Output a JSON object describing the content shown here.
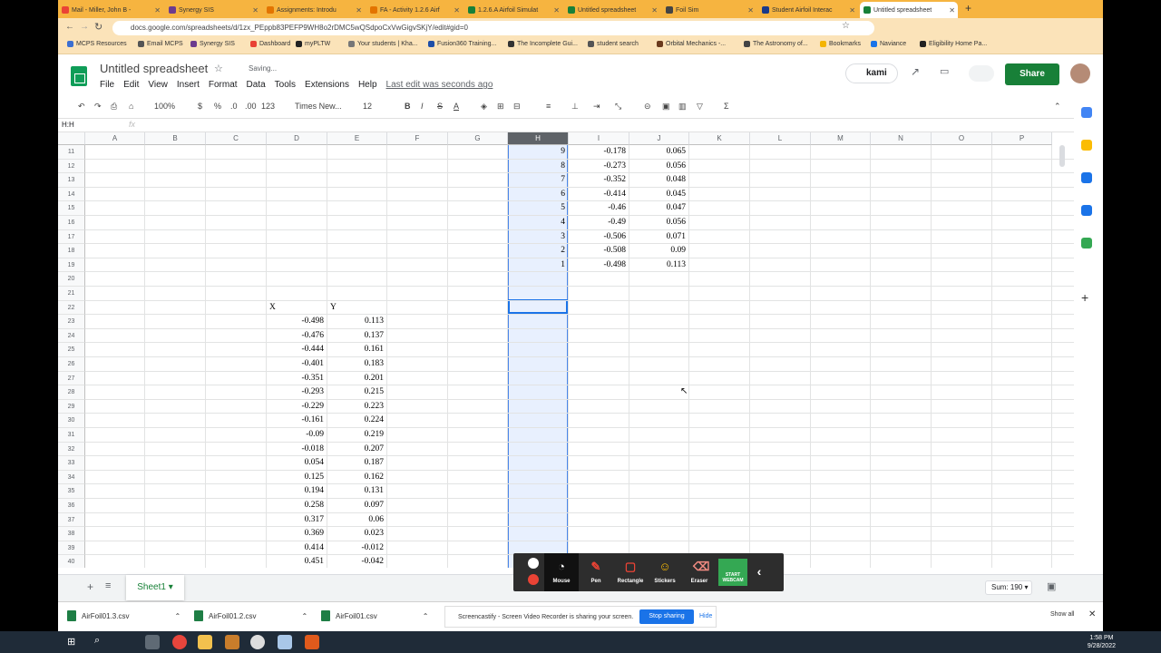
{
  "browser": {
    "tabs": [
      {
        "label": "Mail - Miller, John B -",
        "color": "#ea4335"
      },
      {
        "label": "Synergy SIS",
        "color": "#6d3b8e"
      },
      {
        "label": "Assignments: Introdu",
        "color": "#e37400"
      },
      {
        "label": "FA - Activity 1.2.6 Airf",
        "color": "#e37400"
      },
      {
        "label": "1.2.6.A Airfoil Simulat",
        "color": "#188038"
      },
      {
        "label": "Untitled spreadsheet",
        "color": "#188038"
      },
      {
        "label": "Foil Sim",
        "color": "#444444"
      },
      {
        "label": "Student Airfoil Interac",
        "color": "#1a3a8a"
      },
      {
        "label": "Untitled spreadsheet",
        "color": "#188038"
      }
    ],
    "url": "docs.google.com/spreadsheets/d/1zx_PEppb83PEFP9WH8o2rDMC5wQSdpoCxVwGigvSKjY/edit#gid=0",
    "bookmarks": [
      "MCPS Resources",
      "Email MCPS",
      "Synergy SIS",
      "Dashboard",
      "myPLTW",
      "Your students | Kha...",
      "Fusion360 Training...",
      "The Incomplete Gui...",
      "student search",
      "Orbital Mechanics -...",
      "The Astronomy of...",
      "Bookmarks",
      "Naviance",
      "Eligibility Home Pa..."
    ]
  },
  "sheets": {
    "title": "Untitled spreadsheet",
    "saving": "Saving...",
    "menu": [
      "File",
      "Edit",
      "View",
      "Insert",
      "Format",
      "Data",
      "Tools",
      "Extensions",
      "Help"
    ],
    "last_edit": "Last edit was seconds ago",
    "kami_label": "kami",
    "share_label": "Share",
    "toolbar": {
      "zoom": "100%",
      "currency": "$",
      "percent": "%",
      "dec_less": ".0",
      "dec_more": ".00",
      "format_more": "123",
      "font": "Times New...",
      "font_size": "12"
    },
    "name_box": "H:H",
    "fx": "fx",
    "columns": [
      "A",
      "B",
      "C",
      "D",
      "E",
      "F",
      "G",
      "H",
      "I",
      "J",
      "K",
      "L",
      "M",
      "N",
      "O",
      "P"
    ],
    "selected_column": "H",
    "rows": [
      {
        "row": "11",
        "h": "9",
        "i": "-0.178",
        "j": "0.065"
      },
      {
        "row": "12",
        "h": "8",
        "i": "-0.273",
        "j": "0.056"
      },
      {
        "row": "13",
        "h": "7",
        "i": "-0.352",
        "j": "0.048"
      },
      {
        "row": "14",
        "h": "6",
        "i": "-0.414",
        "j": "0.045"
      },
      {
        "row": "15",
        "h": "5",
        "i": "-0.46",
        "j": "0.047"
      },
      {
        "row": "16",
        "h": "4",
        "i": "-0.49",
        "j": "0.056"
      },
      {
        "row": "17",
        "h": "3",
        "i": "-0.506",
        "j": "0.071"
      },
      {
        "row": "18",
        "h": "2",
        "i": "-0.508",
        "j": "0.09"
      },
      {
        "row": "19",
        "h": "1",
        "i": "-0.498",
        "j": "0.113"
      },
      {
        "row": "20"
      },
      {
        "row": "21"
      },
      {
        "row": "22",
        "d": "X",
        "e": "Y"
      },
      {
        "row": "23",
        "d": "-0.498",
        "e": "0.113"
      },
      {
        "row": "24",
        "d": "-0.476",
        "e": "0.137"
      },
      {
        "row": "25",
        "d": "-0.444",
        "e": "0.161"
      },
      {
        "row": "26",
        "d": "-0.401",
        "e": "0.183"
      },
      {
        "row": "27",
        "d": "-0.351",
        "e": "0.201"
      },
      {
        "row": "28",
        "d": "-0.293",
        "e": "0.215"
      },
      {
        "row": "29",
        "d": "-0.229",
        "e": "0.223"
      },
      {
        "row": "30",
        "d": "-0.161",
        "e": "0.224"
      },
      {
        "row": "31",
        "d": "-0.09",
        "e": "0.219"
      },
      {
        "row": "32",
        "d": "-0.018",
        "e": "0.207"
      },
      {
        "row": "33",
        "d": "0.054",
        "e": "0.187"
      },
      {
        "row": "34",
        "d": "0.125",
        "e": "0.162"
      },
      {
        "row": "35",
        "d": "0.194",
        "e": "0.131"
      },
      {
        "row": "36",
        "d": "0.258",
        "e": "0.097"
      },
      {
        "row": "37",
        "d": "0.317",
        "e": "0.06"
      },
      {
        "row": "38",
        "d": "0.369",
        "e": "0.023"
      },
      {
        "row": "39",
        "d": "0.414",
        "e": "-0.012"
      },
      {
        "row": "40",
        "d": "0.451",
        "e": "-0.042"
      }
    ],
    "sheet_tab": "Sheet1",
    "sum": "Sum: 190"
  },
  "castify": {
    "tools": [
      "Mouse",
      "Pen",
      "Rectangle",
      "Stickers",
      "Eraser"
    ],
    "webcam_label": "START WEBCAM"
  },
  "downloads": [
    "AirFoil01.3.csv",
    "AirFoil01.2.csv",
    "AirFoil01.csv"
  ],
  "show_all": "Show all",
  "share_notice": "Screencastify - Screen Video Recorder is sharing your screen.",
  "stop_sharing": "Stop sharing",
  "hide": "Hide",
  "clock": {
    "time": "1:58 PM",
    "date": "9/28/2022"
  }
}
